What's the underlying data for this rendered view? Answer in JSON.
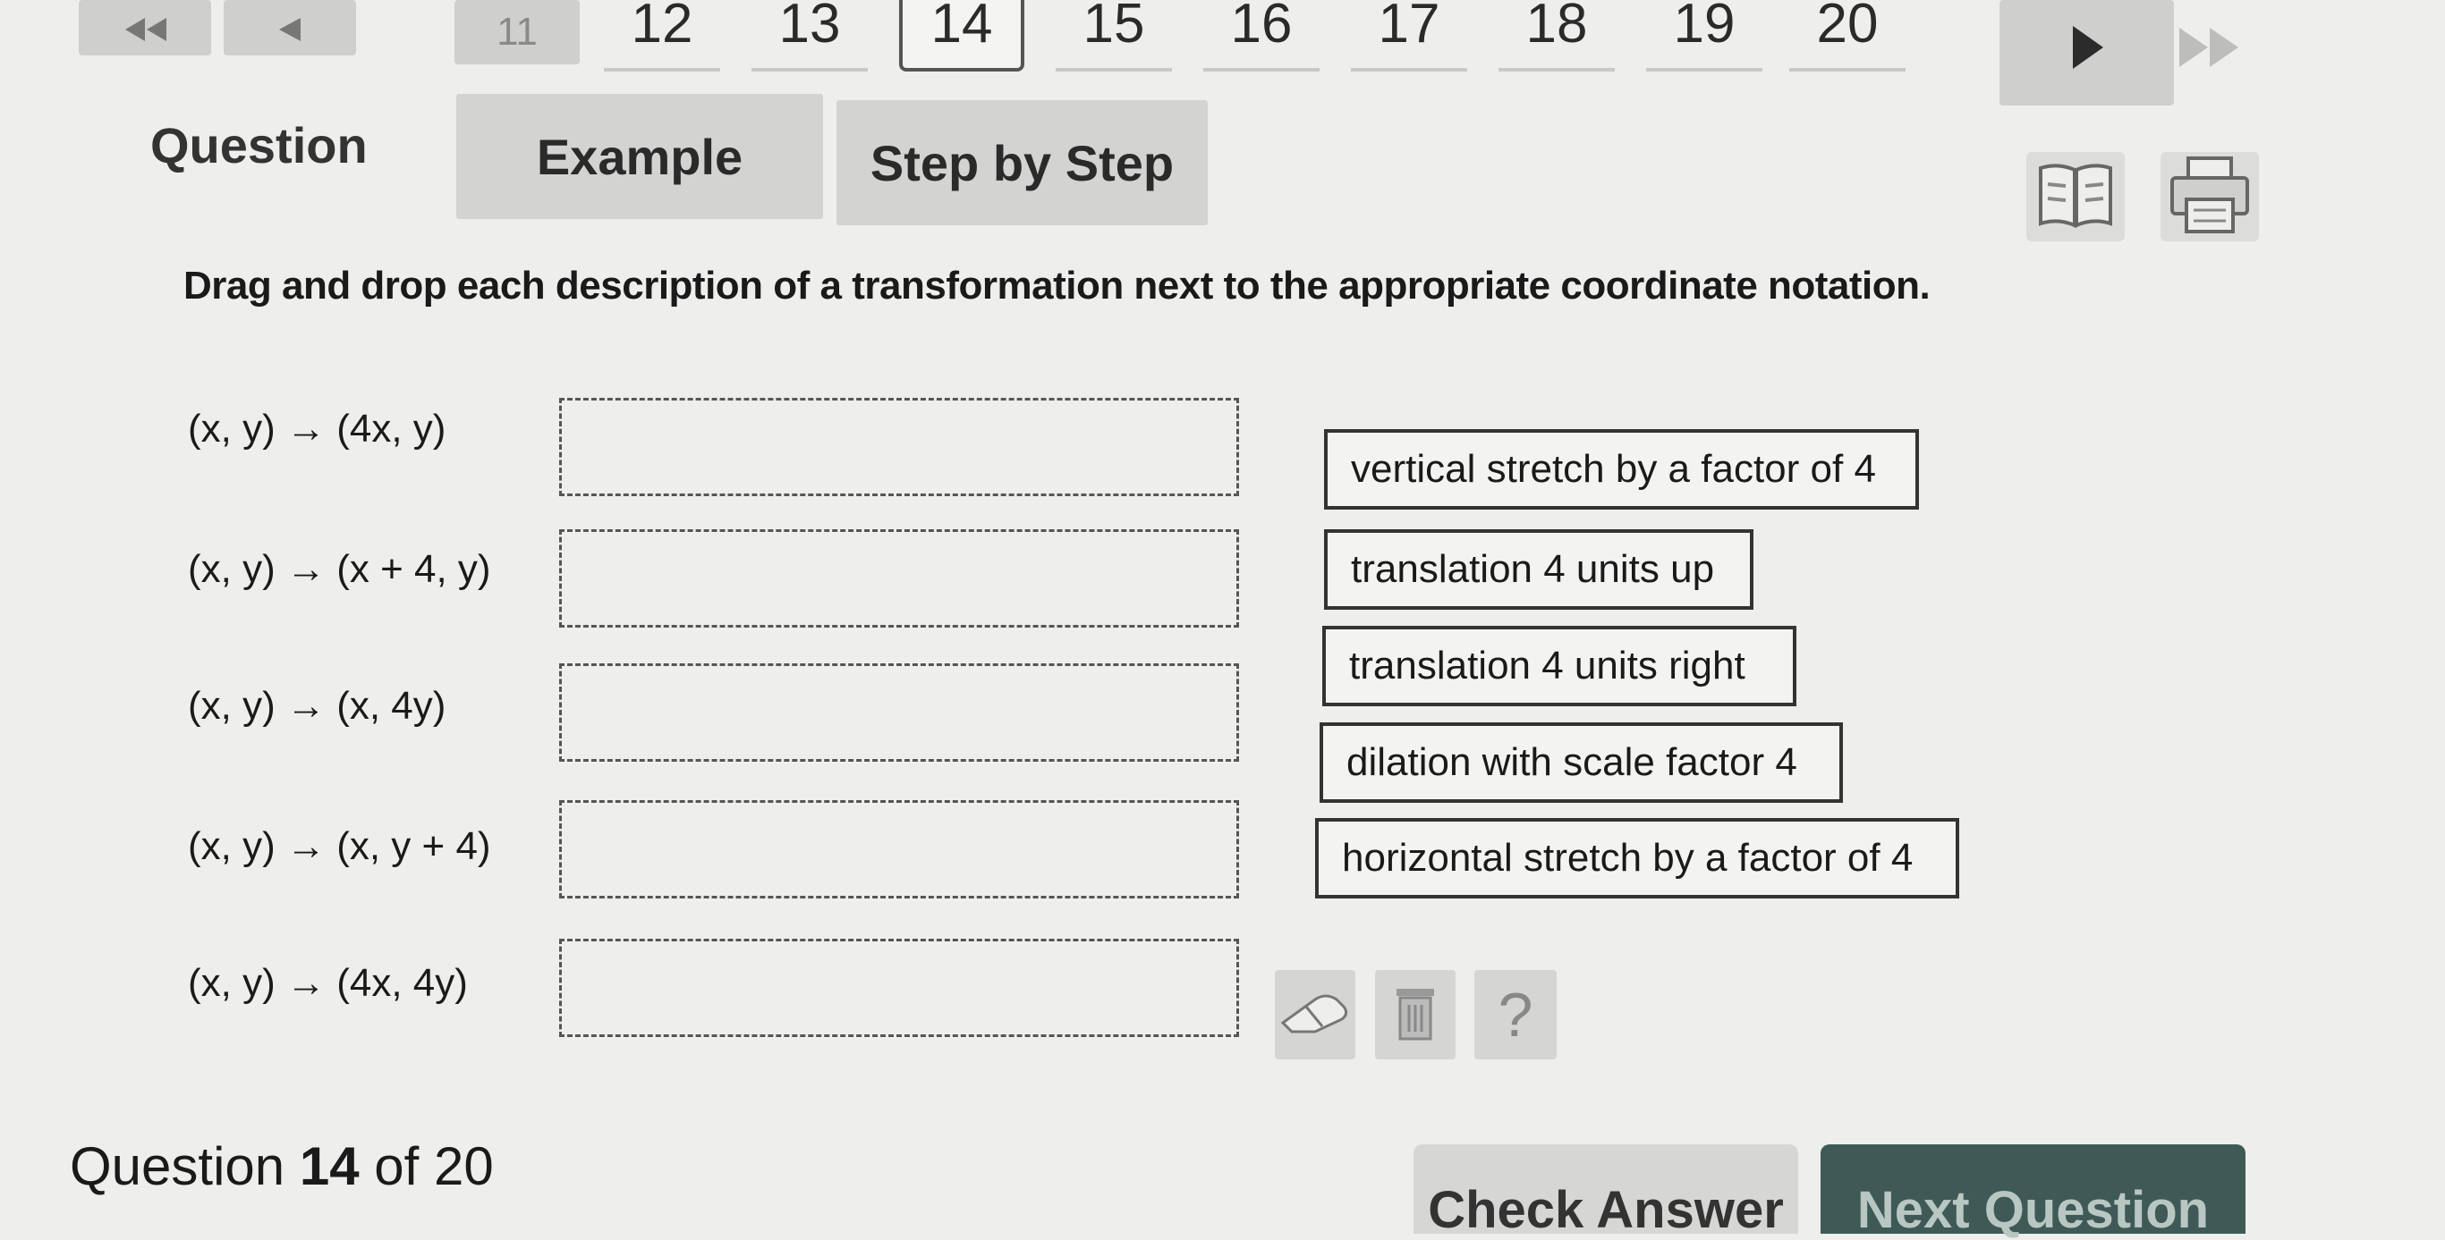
{
  "nav": {
    "first_icon": "double-left-arrow",
    "prev_icon": "left-arrow",
    "partial_number": "11",
    "numbers": [
      "12",
      "13",
      "14",
      "15",
      "16",
      "17",
      "18",
      "19",
      "20"
    ],
    "current": "14",
    "next_icon": "right-arrow",
    "last_icon": "double-right-arrow"
  },
  "tabs": {
    "label": "Question",
    "items": [
      "Example",
      "Step by Step"
    ]
  },
  "tools": {
    "book_icon": "book-icon",
    "print_icon": "printer-icon"
  },
  "instructions": "Drag and drop each description of a transformation next to the appropriate coordinate notation.",
  "rows": [
    {
      "notation": "(x, y) → (4x, y)"
    },
    {
      "notation": "(x, y) → (x + 4, y)"
    },
    {
      "notation": "(x, y) → (x, 4y)"
    },
    {
      "notation": "(x, y) → (x, y + 4)"
    },
    {
      "notation": "(x, y) → (4x, 4y)"
    }
  ],
  "descriptions": [
    "vertical stretch by a factor of 4",
    "translation 4 units up",
    "translation 4 units right",
    "dilation with scale factor 4",
    "horizontal stretch by a factor of 4"
  ],
  "actions": {
    "eraser_icon": "eraser-icon",
    "trash_icon": "trash-icon",
    "help_label": "?"
  },
  "footer": {
    "question_word": "Question",
    "current": "14",
    "of_word": "of",
    "total": "20",
    "check_answer": "Check Answer",
    "next_question": "Next Question"
  }
}
